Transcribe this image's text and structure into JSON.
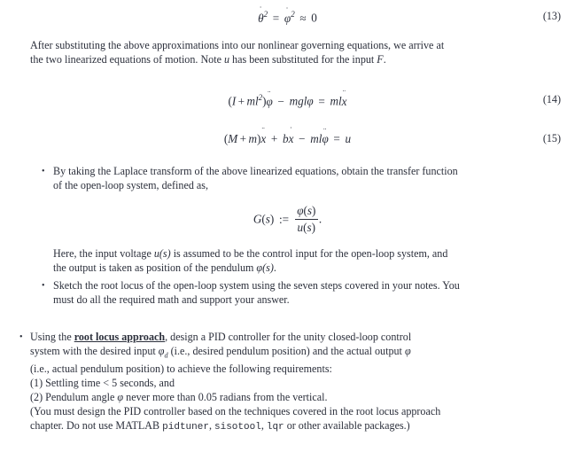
{
  "document": {
    "text_color": "#2b2f3b",
    "background_color": "#ffffff"
  },
  "equations": [
    {
      "number": "(13)",
      "id": "eq-13",
      "description": "theta-dot squared equals phi-dot squared approximately zero"
    },
    {
      "number": "(14)",
      "id": "eq-14",
      "description": "(I + m l squared) phi double dot minus m g l phi equals m l x double dot"
    },
    {
      "number": "(15)",
      "id": "eq-15",
      "description": "(M + m) x double dot plus b x dot minus m l phi double dot equals u"
    }
  ],
  "paragraph_after_eq13": {
    "line1": "After substituting the above approximations into our nonlinear governing equations, we arrive at",
    "line2_part1": "the two linearized equations of motion. Note ",
    "line2_u": "u",
    "line2_part2": " has been substituted for the input ",
    "line2_F": "F",
    "line2_part3": "."
  },
  "bullet_laplace": {
    "line1": "By taking the Laplace transform of the above linearized equations, obtain the transfer function",
    "line2": "of the open-loop system, defined as,"
  },
  "transfer_function": {
    "lhs": "G(s)",
    "assign": ":=",
    "numerator": "φ(s)",
    "denominator": "u(s)",
    "trailing_period": "."
  },
  "paragraph_here": {
    "line1_part1": "Here, the input voltage ",
    "line1_us": "u(s)",
    "line1_part2": " is assumed to be the control input for the open-loop system, and",
    "line2_part1": "the output is taken as position of the pendulum ",
    "line2_phis": "φ(s)",
    "line2_part2": "."
  },
  "bullet_sketch": {
    "line1": "Sketch the root locus of the open-loop system using the seven steps covered in your notes. You",
    "line2": "must do all the required math and support your answer."
  },
  "bullet_pid": {
    "line1_part1": "Using the ",
    "line1_emphasis": "root locus approach",
    "line1_part2": ", design a PID controller for the unity closed-loop control",
    "line2_part1": "system with the desired input ",
    "line2_phi_d": "φ",
    "line2_phi_d_sub": "d",
    "line2_part2": " (i.e., desired pendulum position) and the actual output ",
    "line2_phi": "φ",
    "line3": "(i.e., actual pendulum position) to achieve the following requirements:",
    "req1": "(1) Settling time < 5 seconds, and",
    "req2_part1": "(2) Pendulum angle ",
    "req2_phi": "φ",
    "req2_part2": " never more than 0.05 radians from the vertical.",
    "note_line1": "(You must design the PID controller based on the techniques covered in the root locus approach",
    "note_line2_part1": "chapter. Do not use MATLAB ",
    "note_cmd1": "pidtuner",
    "note_sep1": ", ",
    "note_cmd2": "sisotool",
    "note_sep2": ", ",
    "note_cmd3": "lqr",
    "note_line2_part2": " or other available packages.)"
  },
  "symbols": {
    "theta": "θ",
    "phi": "φ",
    "approx": "≈",
    "equals": "=",
    "minus": "−",
    "plus": "+",
    "bullet_glyph": "•",
    "single_dot": "˙",
    "double_dot": "¨"
  }
}
